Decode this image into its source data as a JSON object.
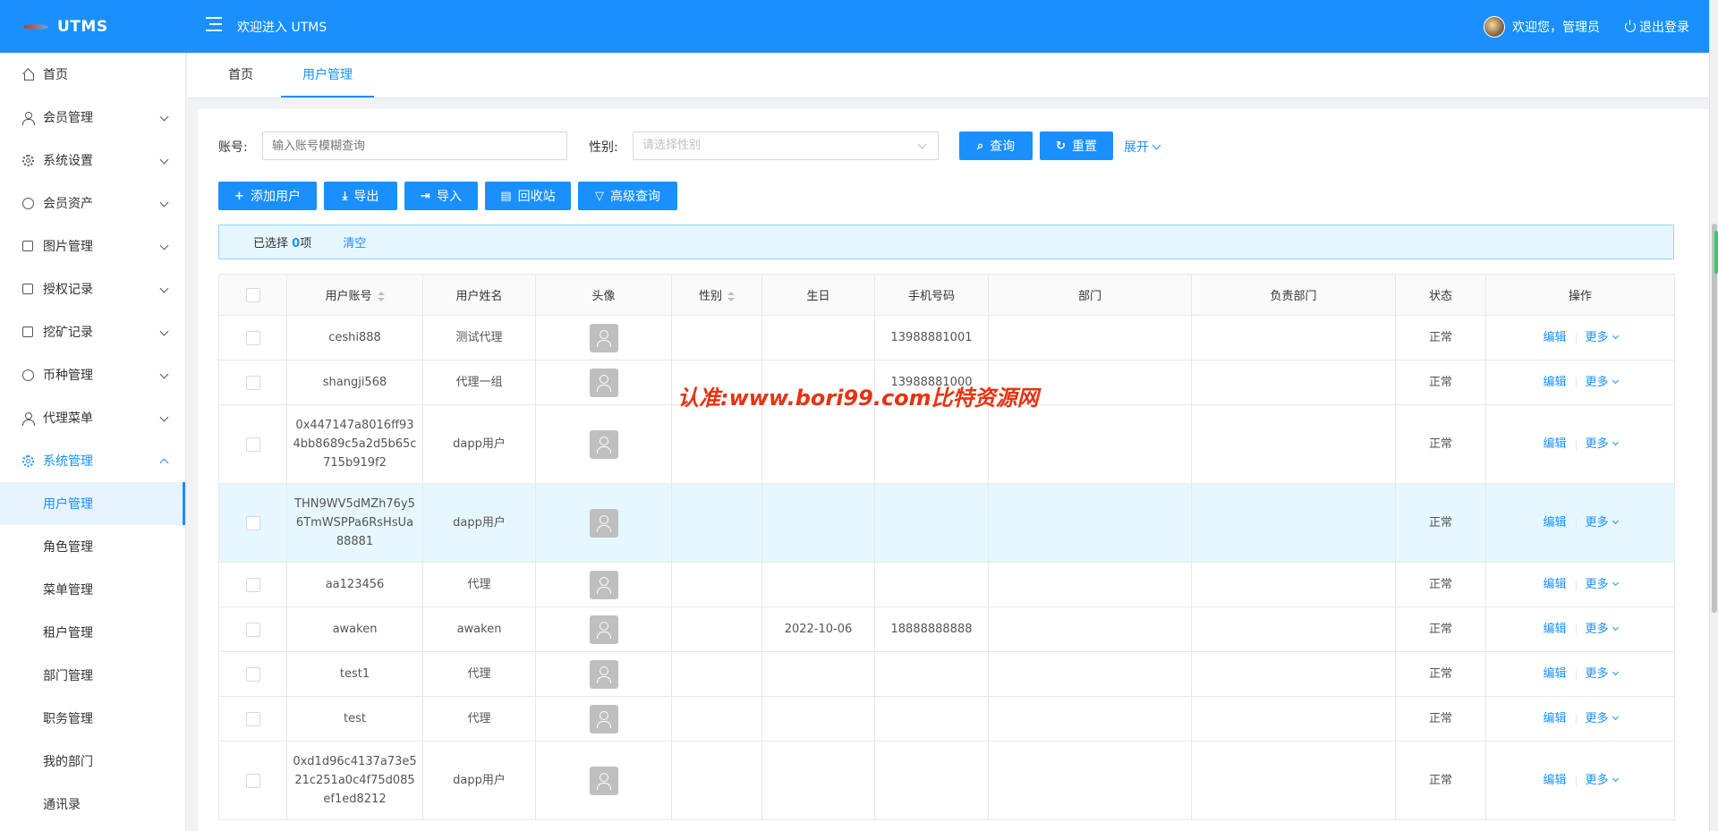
{
  "header": {
    "logo_text": "UTMS",
    "title": "欢迎进入 UTMS",
    "welcome_user": "欢迎您，管理员",
    "logout_label": "退出登录"
  },
  "sidebar": {
    "items": [
      {
        "label": "首页",
        "icon": "home-icon",
        "expandable": false
      },
      {
        "label": "会员管理",
        "icon": "user-icon",
        "expandable": true
      },
      {
        "label": "系统设置",
        "icon": "gear-icon",
        "expandable": true
      },
      {
        "label": "会员资产",
        "icon": "dollar-icon",
        "expandable": true
      },
      {
        "label": "图片管理",
        "icon": "picture-icon",
        "expandable": true
      },
      {
        "label": "授权记录",
        "icon": "image-icon",
        "expandable": true
      },
      {
        "label": "挖矿记录",
        "icon": "document-icon",
        "expandable": true
      },
      {
        "label": "币种管理",
        "icon": "copyright-icon",
        "expandable": true
      },
      {
        "label": "代理菜单",
        "icon": "user-icon",
        "expandable": true
      },
      {
        "label": "系统管理",
        "icon": "gear-icon",
        "expandable": true,
        "open": true
      }
    ],
    "sub_items": [
      {
        "label": "用户管理",
        "active": true
      },
      {
        "label": "角色管理"
      },
      {
        "label": "菜单管理"
      },
      {
        "label": "租户管理"
      },
      {
        "label": "部门管理"
      },
      {
        "label": "职务管理"
      },
      {
        "label": "我的部门"
      },
      {
        "label": "通讯录"
      }
    ]
  },
  "tabs": [
    {
      "label": "首页",
      "active": false
    },
    {
      "label": "用户管理",
      "active": true
    }
  ],
  "search": {
    "account_label": "账号:",
    "account_placeholder": "输入账号模糊查询",
    "gender_label": "性别:",
    "gender_placeholder": "请选择性别",
    "query_label": "查询",
    "reset_label": "重置",
    "expand_label": "展开"
  },
  "toolbar": {
    "add_user": "添加用户",
    "export": "导出",
    "import": "导入",
    "recycle": "回收站",
    "advanced": "高级查询"
  },
  "selection": {
    "prefix": "已选择",
    "count": "0",
    "suffix": "项",
    "clear": "清空"
  },
  "table": {
    "columns": [
      "用户账号",
      "用户姓名",
      "头像",
      "性别",
      "生日",
      "手机号码",
      "部门",
      "负责部门",
      "状态",
      "操作"
    ],
    "edit_label": "编辑",
    "more_label": "更多",
    "rows": [
      {
        "account": "ceshi888",
        "name": "测试代理",
        "gender": "",
        "birthday": "",
        "phone": "13988881001",
        "dept": "",
        "lead_dept": "",
        "status": "正常"
      },
      {
        "account": "shangji568",
        "name": "代理一组",
        "gender": "",
        "birthday": "",
        "phone": "13988881000",
        "dept": "",
        "lead_dept": "",
        "status": "正常"
      },
      {
        "account": "0x447147a8016ff934bb8689c5a2d5b65c715b919f2",
        "name": "dapp用户",
        "gender": "",
        "birthday": "",
        "phone": "",
        "dept": "",
        "lead_dept": "",
        "status": "正常"
      },
      {
        "account": "THN9WV5dMZh76y56TmWSPPa6RsHsUa88881",
        "name": "dapp用户",
        "gender": "",
        "birthday": "",
        "phone": "",
        "dept": "",
        "lead_dept": "",
        "status": "正常",
        "highlight": true
      },
      {
        "account": "aa123456",
        "name": "代理",
        "gender": "",
        "birthday": "",
        "phone": "",
        "dept": "",
        "lead_dept": "",
        "status": "正常"
      },
      {
        "account": "awaken",
        "name": "awaken",
        "gender": "",
        "birthday": "2022-10-06",
        "phone": "18888888888",
        "dept": "",
        "lead_dept": "",
        "status": "正常"
      },
      {
        "account": "test1",
        "name": "代理",
        "gender": "",
        "birthday": "",
        "phone": "",
        "dept": "",
        "lead_dept": "",
        "status": "正常"
      },
      {
        "account": "test",
        "name": "代理",
        "gender": "",
        "birthday": "",
        "phone": "",
        "dept": "",
        "lead_dept": "",
        "status": "正常"
      },
      {
        "account": "0xd1d96c4137a73e521c251a0c4f75d085ef1ed8212",
        "name": "dapp用户",
        "gender": "",
        "birthday": "",
        "phone": "",
        "dept": "",
        "lead_dept": "",
        "status": "正常"
      }
    ]
  },
  "watermark": "认准:www.bori99.com比特资源网",
  "colors": {
    "primary": "#1a90ff",
    "highlight_row": "#e6f7ff"
  }
}
